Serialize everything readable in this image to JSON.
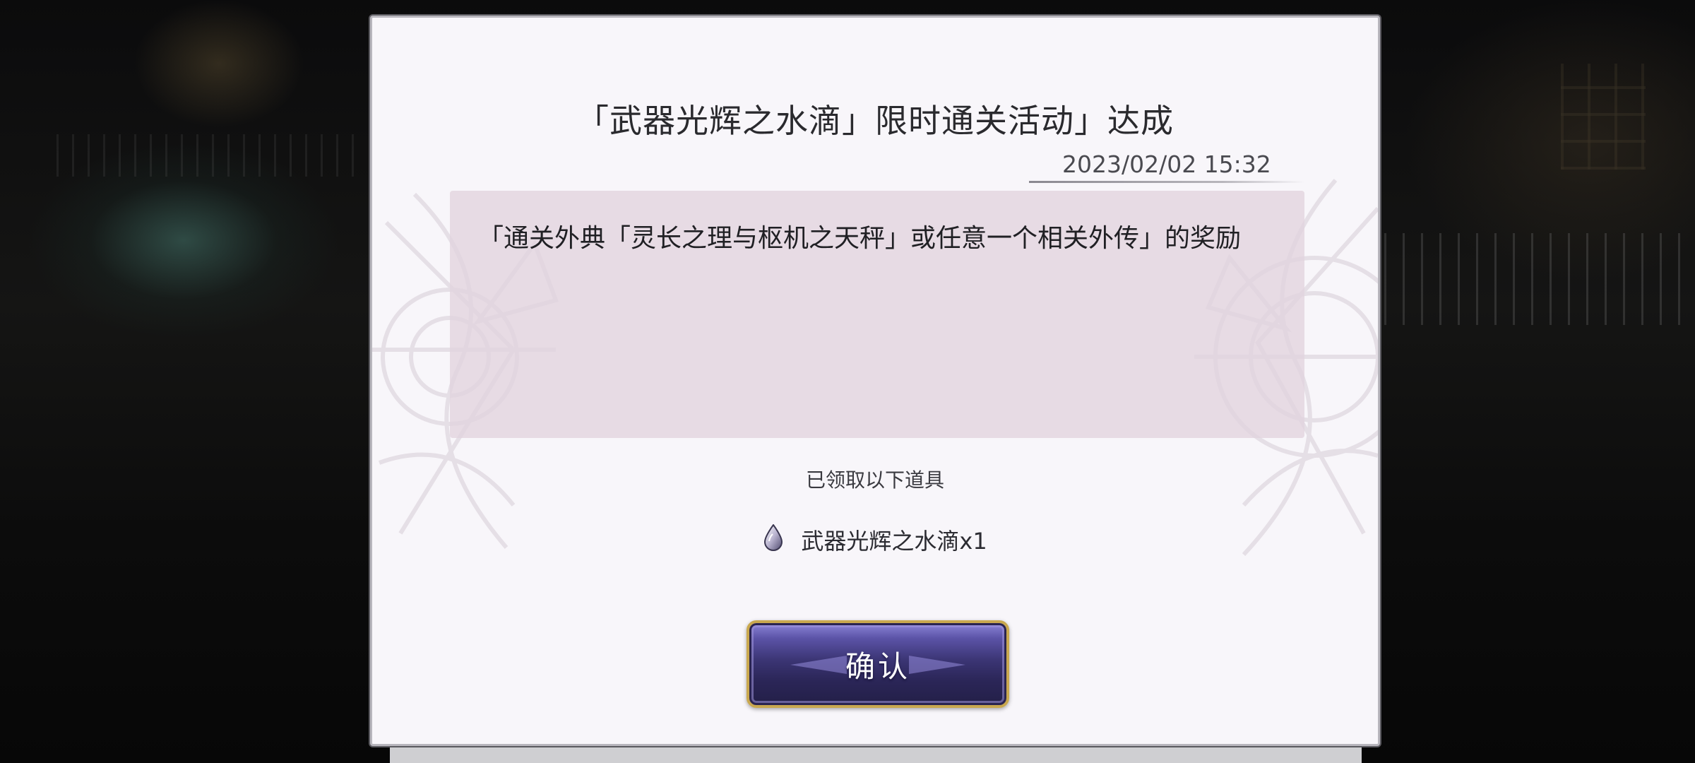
{
  "dialog": {
    "title": "「武器光辉之水滴」限时通关活动」达成",
    "date": "2023/02/02 15:32",
    "description": "「通关外典「灵长之理与枢机之天秤」或任意一个相关外传」的奖励",
    "received_label": "已领取以下道具",
    "reward_item": {
      "icon": "water-drop-icon",
      "label": "武器光辉之水滴x1"
    },
    "confirm_label": "确认"
  },
  "colors": {
    "panel_background": "#f8f6fa",
    "description_background": "#e2d4de",
    "button_gold_border": "#c9a84f",
    "button_purple": "#3b3574"
  }
}
